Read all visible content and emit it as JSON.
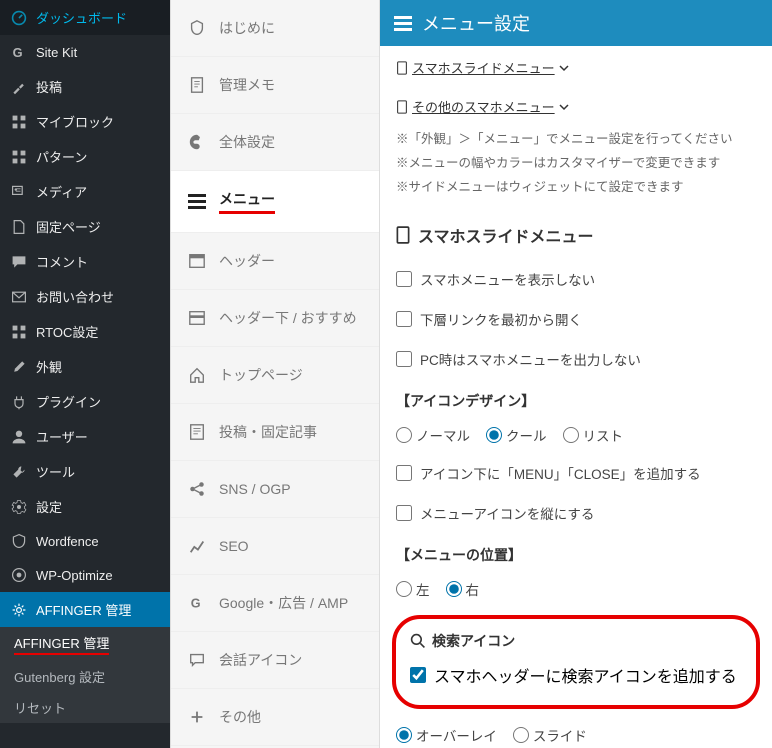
{
  "wp_menu": {
    "items": [
      {
        "icon": "dashboard",
        "label": "ダッシュボード"
      },
      {
        "icon": "g",
        "label": "Site Kit"
      },
      {
        "icon": "pin",
        "label": "投稿"
      },
      {
        "icon": "grid",
        "label": "マイブロック"
      },
      {
        "icon": "grid",
        "label": "パターン"
      },
      {
        "icon": "media",
        "label": "メディア"
      },
      {
        "icon": "page",
        "label": "固定ページ"
      },
      {
        "icon": "comment",
        "label": "コメント"
      },
      {
        "icon": "mail",
        "label": "お問い合わせ"
      },
      {
        "icon": "grid",
        "label": "RTOC設定"
      },
      {
        "icon": "brush",
        "label": "外観"
      },
      {
        "icon": "plug",
        "label": "プラグイン"
      },
      {
        "icon": "user",
        "label": "ユーザー"
      },
      {
        "icon": "tool",
        "label": "ツール"
      },
      {
        "icon": "cog",
        "label": "設定"
      },
      {
        "icon": "shield",
        "label": "Wordfence"
      },
      {
        "icon": "wpo",
        "label": "WP-Optimize"
      },
      {
        "icon": "gear",
        "label": "AFFINGER 管理",
        "active": true
      }
    ],
    "submenu": [
      {
        "label": "AFFINGER 管理",
        "underline": true,
        "current": true
      },
      {
        "label": "Gutenberg 設定"
      },
      {
        "label": "リセット"
      }
    ]
  },
  "settings_menu": {
    "items": [
      {
        "icon": "shield-o",
        "label": "はじめに"
      },
      {
        "icon": "doc",
        "label": "管理メモ"
      },
      {
        "icon": "palette",
        "label": "全体設定"
      },
      {
        "icon": "hamburger",
        "label": "メニュー",
        "active": true
      },
      {
        "icon": "header",
        "label": "ヘッダー"
      },
      {
        "icon": "header-under",
        "label": "ヘッダー下 / おすすめ"
      },
      {
        "icon": "home",
        "label": "トップページ"
      },
      {
        "icon": "post",
        "label": "投稿・固定記事"
      },
      {
        "icon": "share",
        "label": "SNS / OGP"
      },
      {
        "icon": "chart",
        "label": "SEO"
      },
      {
        "icon": "google",
        "label": "Google・広告 / AMP"
      },
      {
        "icon": "chat",
        "label": "会話アイコン"
      },
      {
        "icon": "plus",
        "label": "その他"
      }
    ]
  },
  "content": {
    "header_title": "メニュー設定",
    "tabs": [
      {
        "label": "スマホスライドメニュー",
        "caret": true
      },
      {
        "label": "その他のスマホメニュー",
        "caret": true
      }
    ],
    "notes": [
      "※「外観」＞「メニュー」でメニュー設定を行ってください",
      "※メニューの幅やカラーはカスタマイザーで変更できます",
      "※サイドメニューはウィジェットにて設定できます"
    ],
    "section_title": "スマホスライドメニュー",
    "checkboxes_1": [
      {
        "label": "スマホメニューを表示しない",
        "checked": false
      },
      {
        "label": "下層リンクを最初から開く",
        "checked": false
      },
      {
        "label": "PC時はスマホメニューを出力しない",
        "checked": false
      }
    ],
    "icon_design": {
      "heading": "【アイコンデザイン】",
      "radios": [
        {
          "label": "ノーマル",
          "checked": false
        },
        {
          "label": "クール",
          "checked": true
        },
        {
          "label": "リスト",
          "checked": false
        }
      ],
      "checkboxes": [
        {
          "label": "アイコン下に「MENU」「CLOSE」を追加する",
          "checked": false
        },
        {
          "label": "メニューアイコンを縦にする",
          "checked": false
        }
      ]
    },
    "menu_position": {
      "heading": "【メニューの位置】",
      "radios": [
        {
          "label": "左",
          "checked": false
        },
        {
          "label": "右",
          "checked": true
        }
      ]
    },
    "search_icon": {
      "heading": "検索アイコン",
      "checkbox": {
        "label": "スマホヘッダーに検索アイコンを追加する",
        "checked": true
      }
    },
    "overlay": {
      "radios": [
        {
          "label": "オーバーレイ",
          "checked": true
        },
        {
          "label": "スライド",
          "checked": false
        }
      ]
    }
  }
}
